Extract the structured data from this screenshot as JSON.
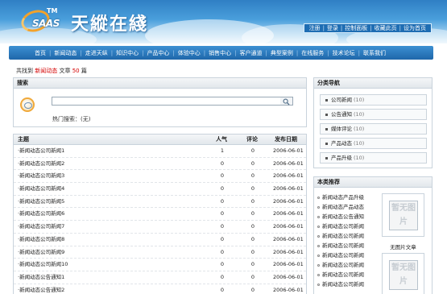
{
  "logo": {
    "tm": "TM",
    "brand": "SAAS",
    "title": "天縱在綫"
  },
  "top_links": [
    "注册",
    "登录",
    "控制面板",
    "收藏此页",
    "设为首页"
  ],
  "nav": [
    "首页",
    "新闻动态",
    "走进天纵",
    "知识中心",
    "产品中心",
    "体验中心",
    "销售中心",
    "客户通道",
    "典型案例",
    "在线服务",
    "技术论坛",
    "联系我们"
  ],
  "summary": {
    "prefix": "共找到",
    "keyword": "新闻动态",
    "mid": "文章",
    "count": "50",
    "suffix": "篇"
  },
  "search": {
    "title": "搜索",
    "value": "",
    "hot_label": "热门搜索：",
    "hot_value": "(无)"
  },
  "list": {
    "headers": {
      "title": "主题",
      "popularity": "人气",
      "comments": "评论",
      "date": "发布日期"
    },
    "rows": [
      {
        "title": "·新闻动态公司新闻1",
        "popularity": "1",
        "comments": "0",
        "date": "2006-06-01"
      },
      {
        "title": "·新闻动态公司新闻2",
        "popularity": "0",
        "comments": "0",
        "date": "2006-06-01"
      },
      {
        "title": "·新闻动态公司新闻3",
        "popularity": "0",
        "comments": "0",
        "date": "2006-06-01"
      },
      {
        "title": "·新闻动态公司新闻4",
        "popularity": "0",
        "comments": "0",
        "date": "2006-06-01"
      },
      {
        "title": "·新闻动态公司新闻5",
        "popularity": "0",
        "comments": "0",
        "date": "2006-06-01"
      },
      {
        "title": "·新闻动态公司新闻6",
        "popularity": "0",
        "comments": "0",
        "date": "2006-06-01"
      },
      {
        "title": "·新闻动态公司新闻7",
        "popularity": "0",
        "comments": "0",
        "date": "2006-06-01"
      },
      {
        "title": "·新闻动态公司新闻8",
        "popularity": "0",
        "comments": "0",
        "date": "2006-06-01"
      },
      {
        "title": "·新闻动态公司新闻9",
        "popularity": "0",
        "comments": "0",
        "date": "2006-06-01"
      },
      {
        "title": "·新闻动态公司新闻10",
        "popularity": "0",
        "comments": "0",
        "date": "2006-06-01"
      },
      {
        "title": "·新闻动态公告通知1",
        "popularity": "0",
        "comments": "0",
        "date": "2006-06-01"
      },
      {
        "title": "·新闻动态公告通知2",
        "popularity": "0",
        "comments": "0",
        "date": "2006-06-01"
      }
    ]
  },
  "categories": {
    "title": "分类导航",
    "items": [
      {
        "label": "公司新闻",
        "count": "(10)"
      },
      {
        "label": "公告通知",
        "count": "(10)"
      },
      {
        "label": "媒体评论",
        "count": "(10)"
      },
      {
        "label": "产品动态",
        "count": "(10)"
      },
      {
        "label": "产品升级",
        "count": "(10)"
      }
    ]
  },
  "recommend": {
    "title": "本类推荐",
    "items": [
      "新闻动态产品升级",
      "新闻动态产品动态",
      "新闻动态公告通知",
      "新闻动态公司新闻",
      "新闻动态公司新闻",
      "新闻动态公司新闻",
      "新闻动态公司新闻",
      "新闻动态公司新闻",
      "新闻动态公司新闻",
      "新闻动态公司新闻"
    ],
    "no_image_text": "暂无图片",
    "no_image_caption": "无图片文章"
  },
  "colors": {
    "nav_bg": "#1f67aa",
    "accent_red": "#d40000",
    "header_blue": "#2f7fc4"
  }
}
